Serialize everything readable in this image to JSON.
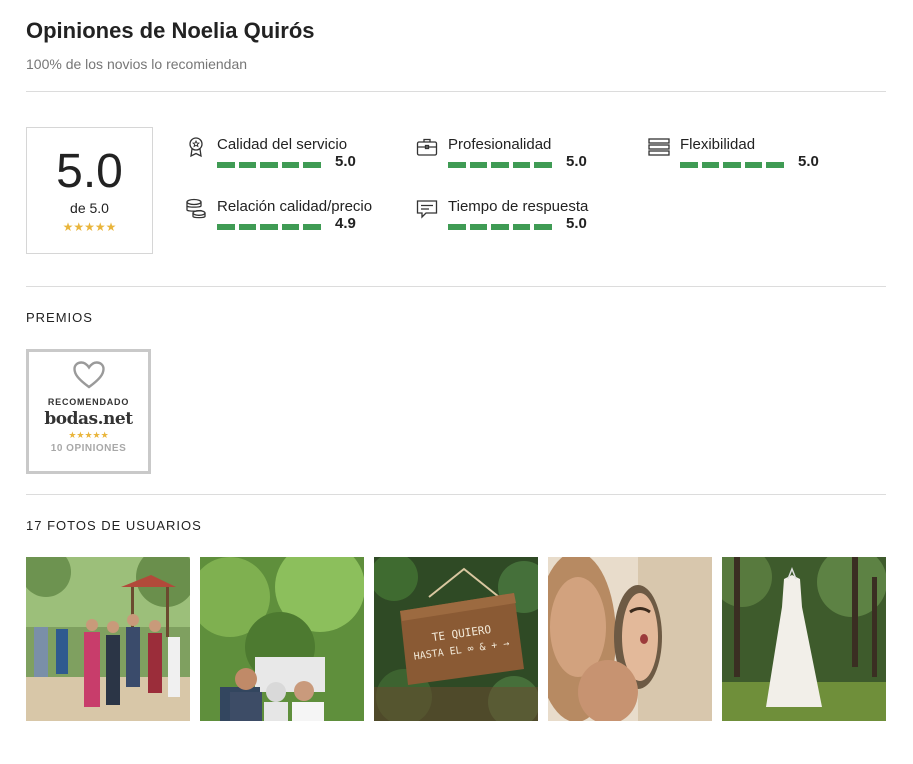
{
  "header": {
    "title": "Opiniones de Noelia Quirós",
    "subtitle": "100% de los novios lo recomiendan"
  },
  "rating": {
    "score": "5.0",
    "out_of": "de 5.0",
    "stars": "★★★★★",
    "star_color": "#e9b53c"
  },
  "categories": [
    {
      "label": "Calidad del servicio",
      "value": "5.0",
      "icon": "award-ribbon-icon"
    },
    {
      "label": "Profesionalidad",
      "value": "5.0",
      "icon": "briefcase-icon"
    },
    {
      "label": "Flexibilidad",
      "value": "5.0",
      "icon": "flexibility-bars-icon"
    },
    {
      "label": "Relación calidad/precio",
      "value": "4.9",
      "icon": "coins-stack-icon"
    },
    {
      "label": "Tiempo de respuesta",
      "value": "5.0",
      "icon": "chat-bubble-icon"
    }
  ],
  "bar_color": "#3f9b54",
  "awards": {
    "heading": "PREMIOS",
    "badge": {
      "line1": "RECOMENDADO",
      "brand": "bodas.net",
      "stars": "★★★★★",
      "count": "10 OPINIONES"
    }
  },
  "photos": {
    "heading": "17 FOTOS DE USUARIOS",
    "items": [
      {
        "name": "wedding-guests-photo"
      },
      {
        "name": "couple-portrait-photo"
      },
      {
        "name": "wooden-sign-photo",
        "sign_line1": "TE QUIERO",
        "sign_line2": "HASTA EL ∞ & + →"
      },
      {
        "name": "mirror-makeup-photo"
      },
      {
        "name": "wedding-dress-photo"
      }
    ]
  }
}
